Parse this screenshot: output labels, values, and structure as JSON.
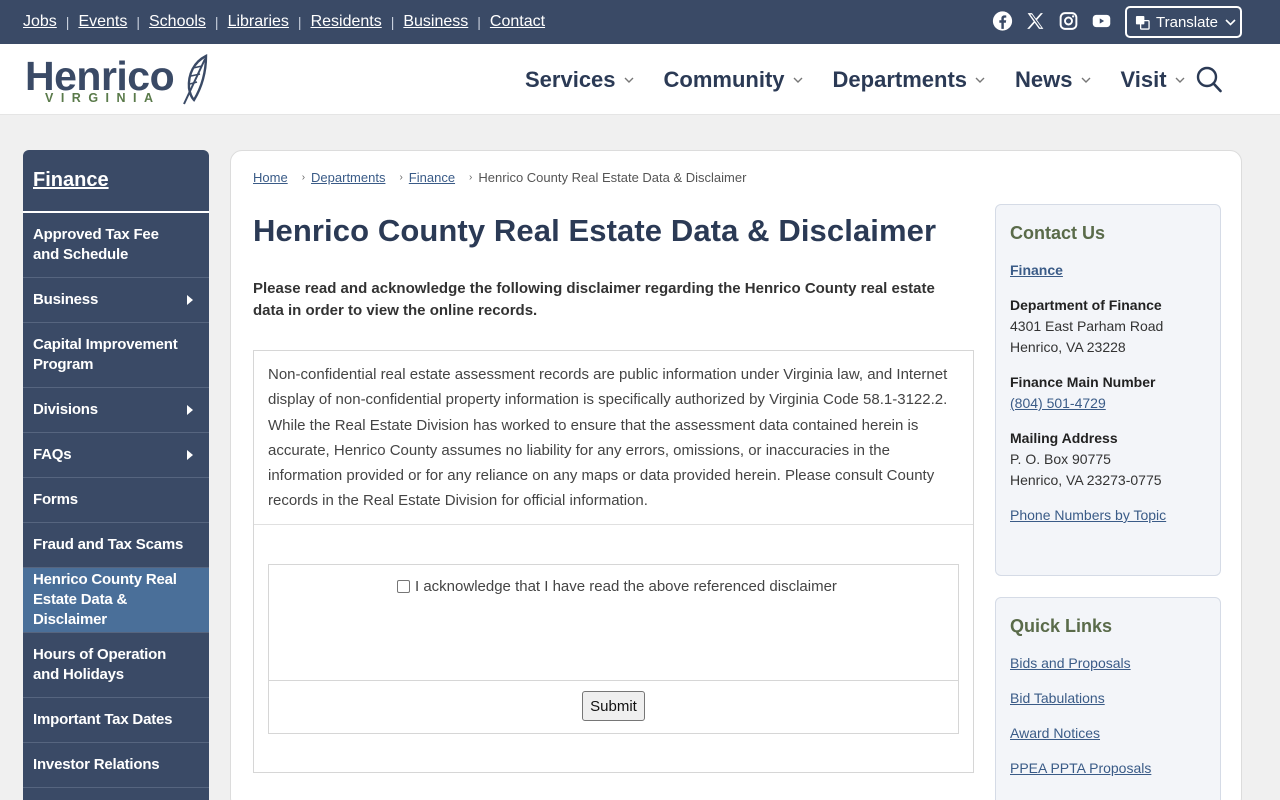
{
  "utility": {
    "links": [
      "Jobs",
      "Events",
      "Schools",
      "Libraries",
      "Residents",
      "Business",
      "Contact"
    ],
    "social": [
      "facebook-icon",
      "x-icon",
      "instagram-icon",
      "youtube-icon"
    ],
    "translate_label": "Translate"
  },
  "header": {
    "logo_word": "Henrico",
    "logo_sub": "VIRGINIA",
    "nav": [
      "Services",
      "Community",
      "Departments",
      "News",
      "Visit"
    ]
  },
  "sidebar": {
    "title": "Finance",
    "items": [
      {
        "label": "Approved Tax Fee and Schedule",
        "has_children": false
      },
      {
        "label": "Business",
        "has_children": true
      },
      {
        "label": "Capital Improvement Program",
        "has_children": false
      },
      {
        "label": "Divisions",
        "has_children": true
      },
      {
        "label": "FAQs",
        "has_children": true
      },
      {
        "label": "Forms",
        "has_children": false
      },
      {
        "label": "Fraud and Tax Scams",
        "has_children": false
      },
      {
        "label": "Henrico County Real Estate Data & Disclaimer",
        "has_children": false,
        "active": true
      },
      {
        "label": "Hours of Operation and Holidays",
        "has_children": false
      },
      {
        "label": "Important Tax Dates",
        "has_children": false
      },
      {
        "label": "Investor Relations",
        "has_children": false
      }
    ]
  },
  "breadcrumb": {
    "items": [
      "Home",
      "Departments",
      "Finance"
    ],
    "current": "Henrico County Real Estate Data & Disclaimer"
  },
  "main": {
    "title": "Henrico County Real Estate Data & Disclaimer",
    "intro": "Please read and acknowledge the following disclaimer regarding the Henrico County real estate data in order to view the online records.",
    "disclaimer": "Non-confidential real estate assessment records are public information under Virginia law, and Internet display of non-confidential property information is specifically authorized by Virginia Code 58.1-3122.2. While the Real Estate Division has worked to ensure that the assessment data contained herein is accurate, Henrico County assumes no liability for any errors, omissions, or inaccuracies in the information provided or for any reliance on any maps or data provided herein. Please consult County records in the Real Estate Division for official information.",
    "acknowledge_label": "I acknowledge that I have read the above referenced disclaimer",
    "submit_label": "Submit"
  },
  "contact": {
    "title": "Contact Us",
    "dept_link": "Finance",
    "dept_name": "Department of Finance",
    "address1": "4301 East Parham Road",
    "address2": "Henrico, VA 23228",
    "main_number_label": "Finance Main Number",
    "main_number": "(804) 501-4729",
    "mailing_label": "Mailing Address",
    "mailing1": "P. O. Box 90775",
    "mailing2": "Henrico, VA 23273-0775",
    "phone_topics": "Phone Numbers by Topic"
  },
  "quick_links": {
    "title": "Quick Links",
    "items": [
      "Bids and Proposals",
      "Bid Tabulations",
      "Award Notices",
      "PPEA PPTA Proposals"
    ]
  }
}
